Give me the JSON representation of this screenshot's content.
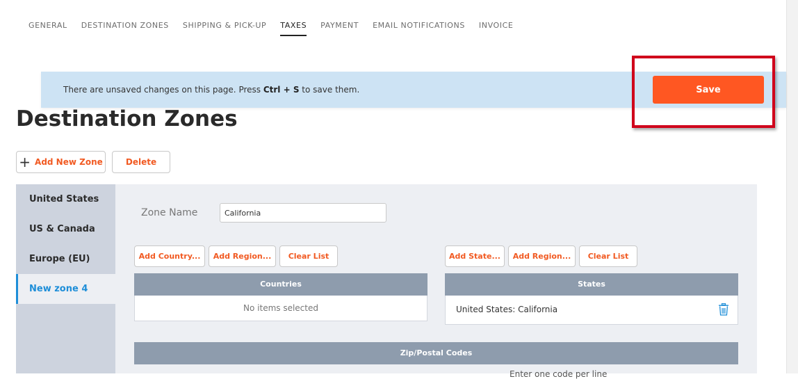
{
  "tabs": [
    {
      "label": "GENERAL",
      "active": false
    },
    {
      "label": "DESTINATION ZONES",
      "active": false
    },
    {
      "label": "SHIPPING & PICK-UP",
      "active": false
    },
    {
      "label": "TAXES",
      "active": true
    },
    {
      "label": "PAYMENT",
      "active": false
    },
    {
      "label": "EMAIL NOTIFICATIONS",
      "active": false
    },
    {
      "label": "INVOICE",
      "active": false
    }
  ],
  "banner": {
    "text_before": "There are unsaved changes on this page. Press ",
    "shortcut": "Ctrl + S",
    "text_after": " to save them.",
    "save_label": "Save"
  },
  "page_title": "Destination Zones",
  "toolbar": {
    "add_zone_label": "Add New Zone",
    "delete_label": "Delete"
  },
  "zones": [
    {
      "label": "United States",
      "active": false
    },
    {
      "label": "US & Canada",
      "active": false
    },
    {
      "label": "Europe (EU)",
      "active": false
    },
    {
      "label": "New zone 4",
      "active": true
    }
  ],
  "zone_form": {
    "name_label": "Zone Name",
    "name_value": "California"
  },
  "countries": {
    "buttons": [
      "Add Country...",
      "Add Region...",
      "Clear List"
    ],
    "header": "Countries",
    "empty_text": "No items selected"
  },
  "states": {
    "buttons": [
      "Add State...",
      "Add Region...",
      "Clear List"
    ],
    "header": "States",
    "items": [
      "United States: California"
    ]
  },
  "zip": {
    "header": "Zip/Postal Codes",
    "hint": "Enter one code per line"
  },
  "colors": {
    "accent": "#f15a22",
    "save": "#ff5722",
    "link_active": "#1e8ed8",
    "banner_bg": "#cde3f4",
    "highlight": "#d0021b"
  }
}
